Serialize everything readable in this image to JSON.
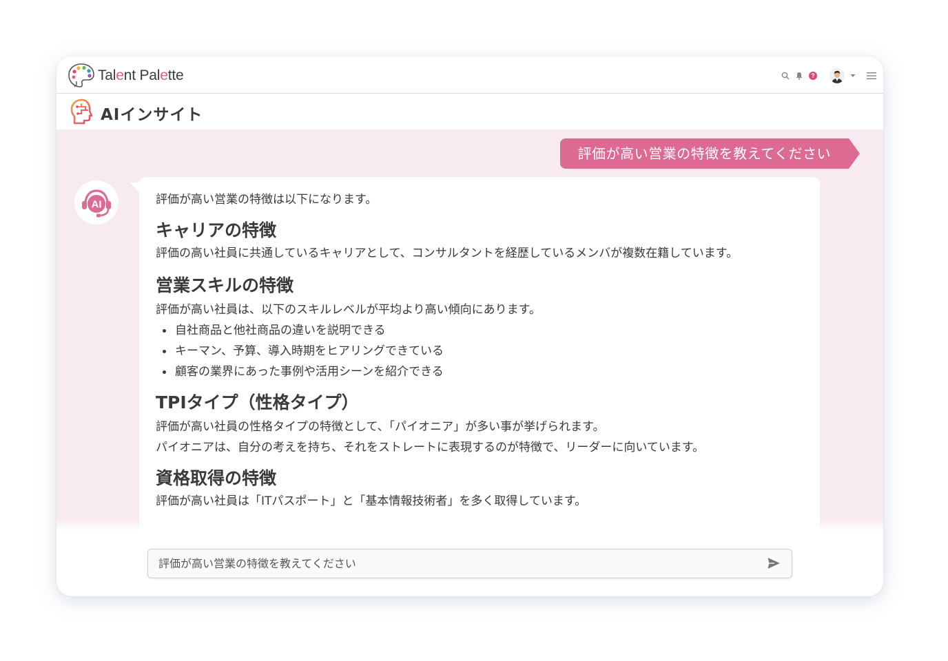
{
  "app": {
    "brand_prefix": "Tal",
    "brand_e1": "e",
    "brand_mid": "nt Pal",
    "brand_e2": "e",
    "brand_suffix": "tte"
  },
  "feature": {
    "title": "AIインサイト"
  },
  "user_message": "評価が高い営業の特徴を教えてください",
  "ai_avatar_label": "AI",
  "answer": {
    "intro": "評価が高い営業の特徴は以下になります。",
    "sections": [
      {
        "heading": "キャリアの特徴",
        "paragraphs": [
          "評価の高い社員に共通しているキャリアとして、コンサルタントを経歴しているメンバが複数在籍しています。"
        ]
      },
      {
        "heading": "営業スキルの特徴",
        "paragraphs": [
          "評価が高い社員は、以下のスキルレベルが平均より高い傾向にあります。"
        ],
        "bullets": [
          "自社商品と他社商品の違いを説明できる",
          "キーマン、予算、導入時期をヒアリングできている",
          "顧客の業界にあった事例や活用シーンを紹介できる"
        ]
      },
      {
        "heading": "TPIタイプ（性格タイプ）",
        "paragraphs": [
          "評価が高い社員の性格タイプの特徴として、「パイオニア」が多い事が挙げられます。",
          "パイオニアは、自分の考えを持ち、それをストレートに表現するのが特徴で、リーダーに向いています。"
        ]
      },
      {
        "heading": "資格取得の特徴",
        "paragraphs": [
          "評価が高い社員は「ITパスポート」と「基本情報技術者」を多く取得しています。"
        ]
      }
    ]
  },
  "input": {
    "value": "評価が高い営業の特徴を教えてください"
  },
  "icons": {
    "search": "search-icon",
    "bell": "bell-icon",
    "help": "help-icon",
    "help_glyph": "?",
    "menu": "hamburger-menu-icon",
    "send": "send-icon"
  },
  "colors": {
    "accent": "#dd6a93",
    "chat_bg": "#f8eaf1"
  }
}
